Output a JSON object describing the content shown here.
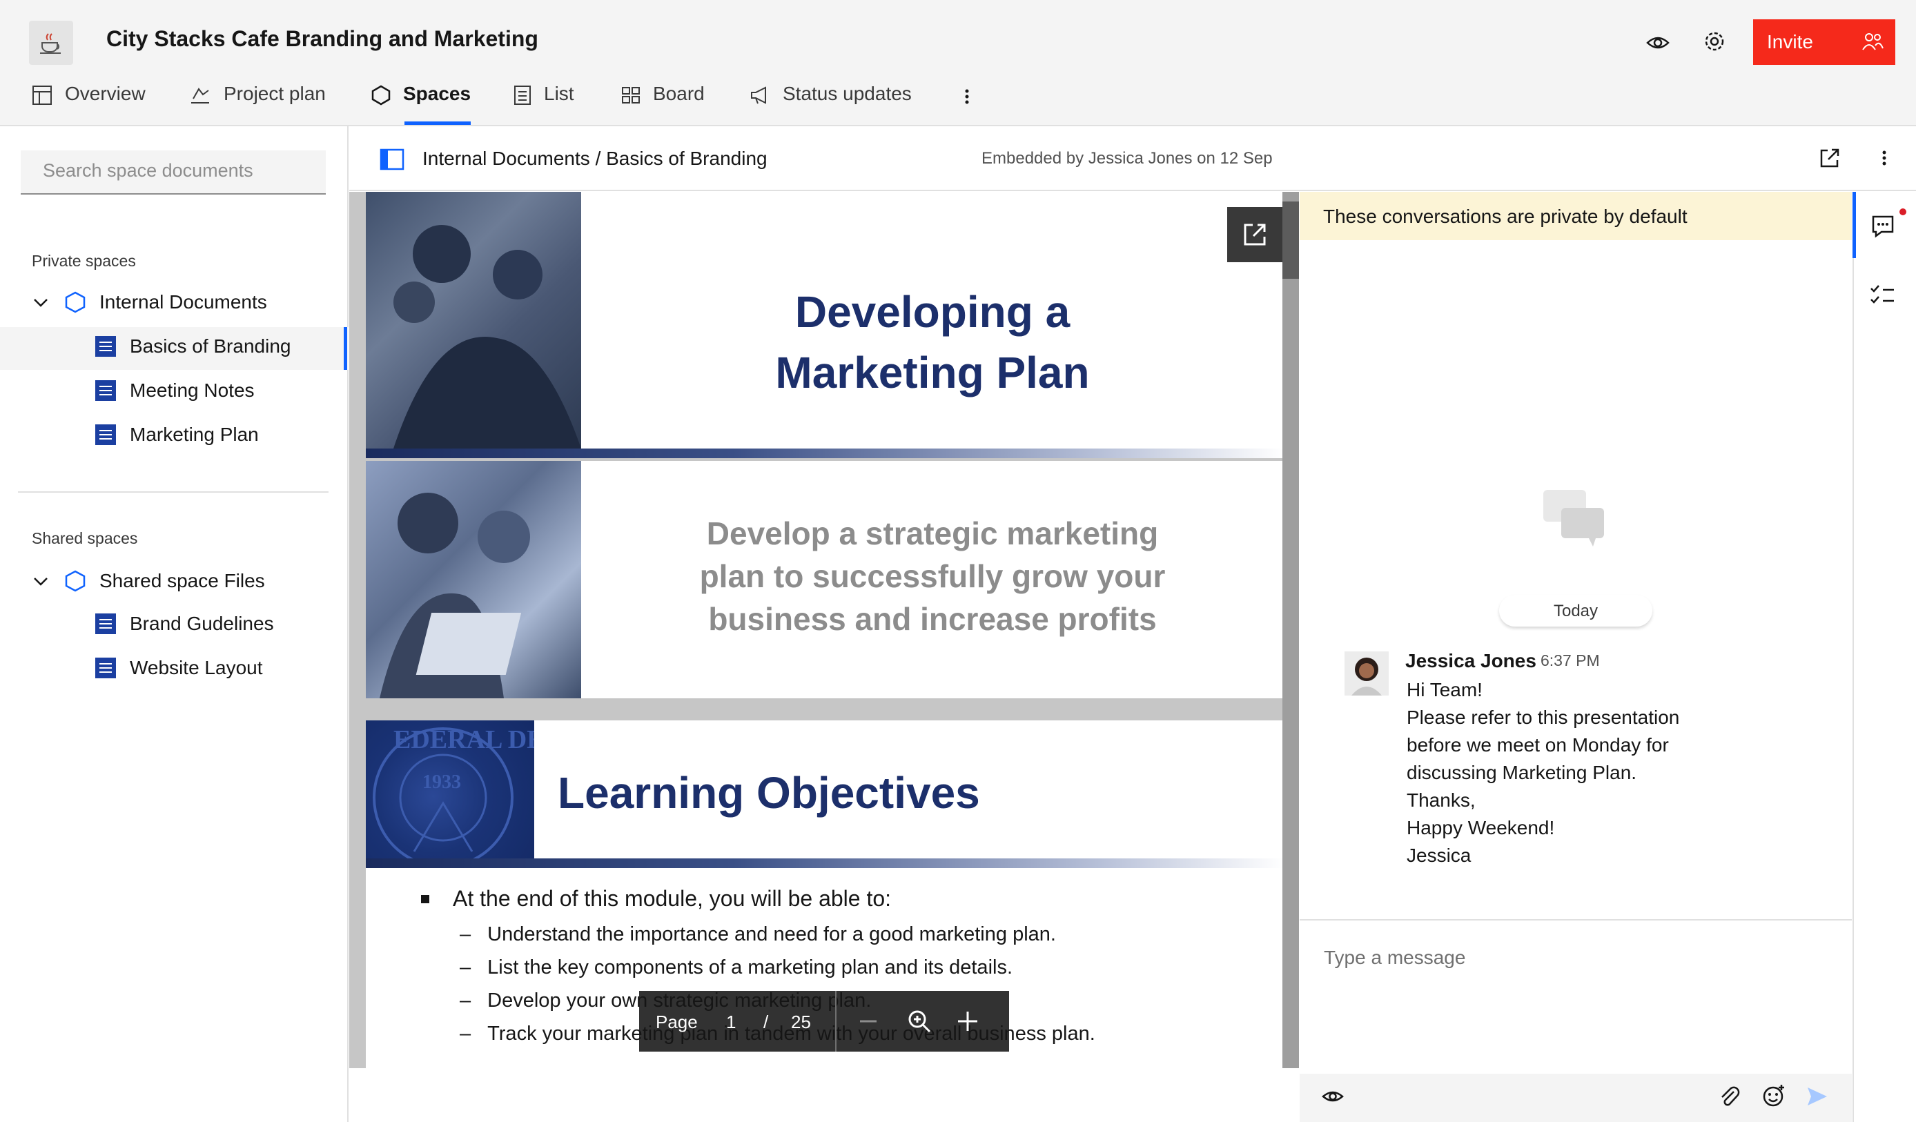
{
  "header": {
    "project_title": "City Stacks Cafe Branding and Marketing",
    "invite_label": "Invite",
    "tabs": [
      {
        "label": "Overview"
      },
      {
        "label": "Project plan"
      },
      {
        "label": "Spaces"
      },
      {
        "label": "List"
      },
      {
        "label": "Board"
      },
      {
        "label": "Status updates"
      }
    ],
    "active_tab": "Spaces"
  },
  "sidebar": {
    "search_placeholder": "Search space documents",
    "private_label": "Private spaces",
    "private_space": "Internal Documents",
    "private_docs": [
      "Basics of Branding",
      "Meeting Notes",
      "Marketing Plan"
    ],
    "selected_doc": "Basics of Branding",
    "shared_label": "Shared spaces",
    "shared_space": "Shared space Files",
    "shared_docs": [
      "Brand Gudelines",
      "Website Layout"
    ]
  },
  "doc": {
    "breadcrumb": "Internal Documents / Basics of Branding",
    "embedded_by": "Embedded by Jessica Jones on 12 Sep"
  },
  "slides": {
    "title": [
      "Developing a",
      "Marketing Plan"
    ],
    "subtitle": [
      "Develop a strategic marketing",
      "plan to successfully grow your",
      "business and increase profits"
    ],
    "objectives_title": "Learning Objectives",
    "objectives_intro": "At the end of this module, you will be able to:",
    "objectives": [
      "Understand the importance and need for a good marketing plan.",
      "List the key components of a marketing plan and its details.",
      "Develop your own strategic marketing plan.",
      "Track your marketing plan in tandem with your overall business plan."
    ],
    "seal_text": "EDERAL DE",
    "seal_year": "1933"
  },
  "pdf_toolbar": {
    "page_label": "Page",
    "current_page": "1",
    "separator": "/",
    "total_pages": "25"
  },
  "chat": {
    "banner": "These conversations are private by default",
    "day_label": "Today",
    "message": {
      "author": "Jessica Jones",
      "time": "6:37 PM",
      "lines": [
        "Hi Team!",
        "Please refer to this presentation",
        "before we meet on Monday for",
        "discussing Marketing Plan.",
        "Thanks,",
        "Happy Weekend!",
        "Jessica"
      ]
    },
    "input_placeholder": "Type a message"
  },
  "colors": {
    "accent": "#0f62fe",
    "invite": "#f5291b",
    "slide_navy": "#1c2f6b",
    "banner": "#fcf4d6"
  }
}
